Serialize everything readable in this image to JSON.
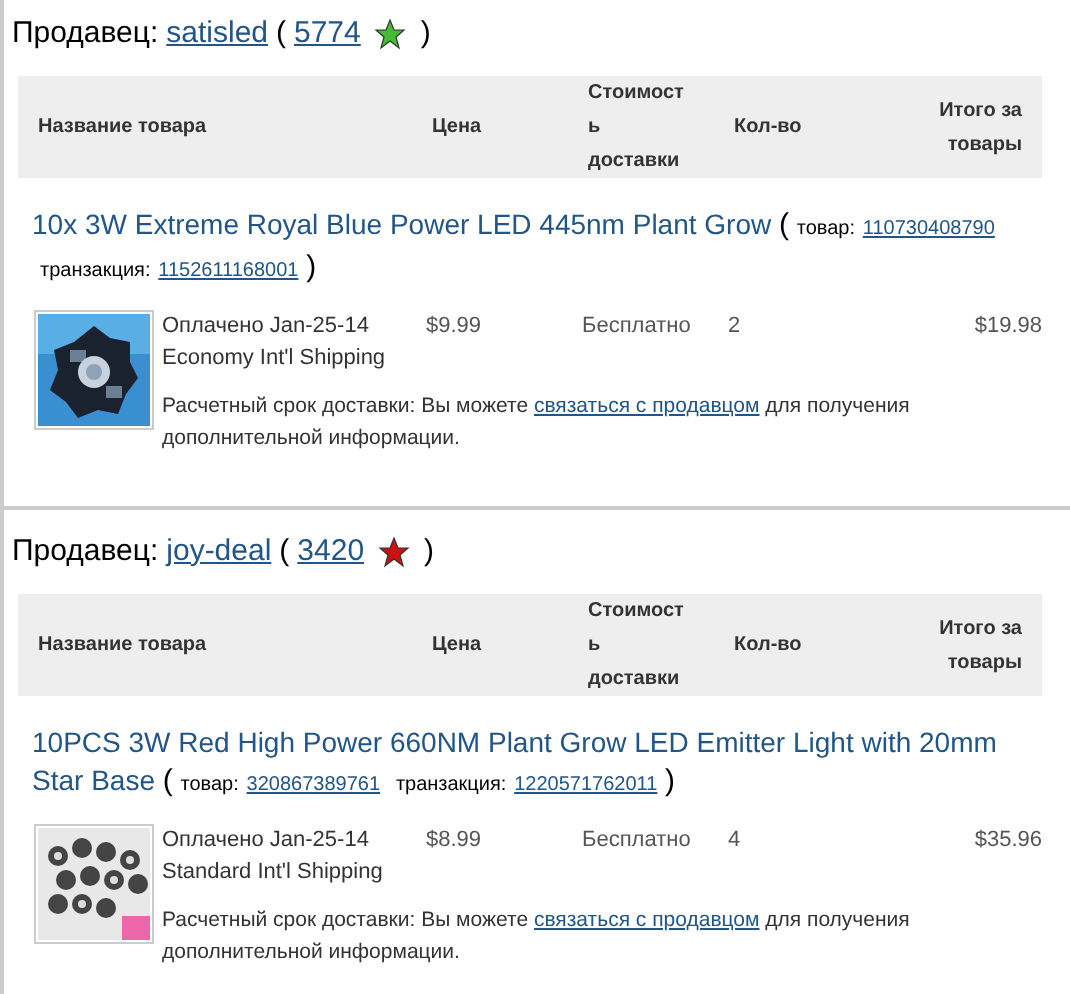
{
  "sellers": [
    {
      "label": "Продавец:",
      "name": "satisled",
      "open": "(",
      "score": "5774",
      "star": {
        "color": "#44bb33"
      },
      "close": ")",
      "columns": [
        "Название товара",
        "Цена",
        "Стоимост ь доставки",
        "Кол-во",
        "Итого за товары"
      ],
      "item": {
        "title": "10x 3W Extreme Royal Blue Power LED 445nm Plant Grow",
        "open": "(",
        "item_label": "товар:",
        "item_id": "110730408790",
        "txn_label": "транзакция:",
        "txn_id": "1152611168001",
        "close": ")",
        "paid": "Оплачено Jan-25-14",
        "shipping_method": "Economy Int'l Shipping",
        "price": "$9.99",
        "shipping": "Бесплатно",
        "qty": "2",
        "total": "$19.98",
        "delivery_before": "Расчетный срок доставки: Вы можете",
        "contact_link": "связаться с продавцом",
        "delivery_after": "для получения дополнительной информации."
      }
    },
    {
      "label": "Продавец:",
      "name": "joy-deal",
      "open": "(",
      "score": "3420",
      "star": {
        "color": "#cc1111"
      },
      "close": ")",
      "columns": [
        "Название товара",
        "Цена",
        "Стоимост ь доставки",
        "Кол-во",
        "Итого за товары"
      ],
      "item": {
        "title": "10PCS 3W Red High Power 660NM Plant Grow LED Emitter Light with 20mm Star Base",
        "open": "(",
        "item_label": "товар:",
        "item_id": "320867389761",
        "txn_label": "транзакция:",
        "txn_id": "1220571762011",
        "close": ")",
        "paid": "Оплачено Jan-25-14",
        "shipping_method": "Standard Int'l Shipping",
        "price": "$8.99",
        "shipping": "Бесплатно",
        "qty": "4",
        "total": "$35.96",
        "delivery_before": "Расчетный срок доставки: Вы можете",
        "contact_link": "связаться с продавцом",
        "delivery_after": "для получения дополнительной информации."
      }
    }
  ]
}
